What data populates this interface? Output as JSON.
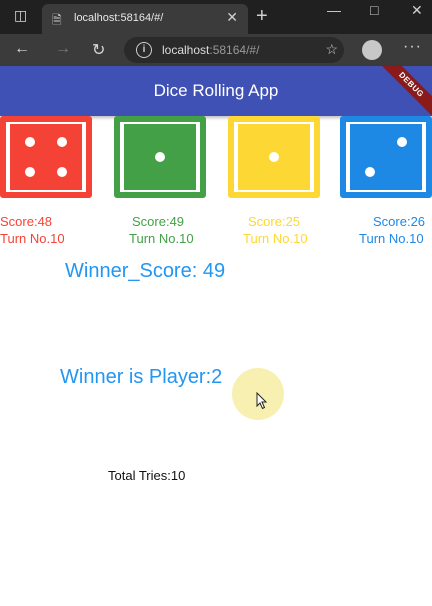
{
  "browser": {
    "tab_title": "localhost:58164/#/",
    "url_host": "localhost",
    "url_rest": ":58164/#/"
  },
  "app": {
    "title": "Dice Rolling App",
    "debug_banner": "DEBUG",
    "appbar_color": "#3f51b5"
  },
  "players": [
    {
      "color": "#f44336",
      "face": 4,
      "score_label": "Score:48",
      "turn_label": "Turn No.10"
    },
    {
      "color": "#43a047",
      "face": 1,
      "score_label": "Score:49",
      "turn_label": "Turn No.10"
    },
    {
      "color": "#fdd835",
      "face": 1,
      "score_label": "Score:25",
      "turn_label": "Turn No.10"
    },
    {
      "color": "#1e88e5",
      "face": 2,
      "score_label": "Score:26",
      "turn_label": "Turn No.10"
    }
  ],
  "results": {
    "winner_score": "Winner_Score: 49",
    "winner_player": "Winner is Player:2",
    "total_tries": "Total Tries:10"
  },
  "icons": [
    "sidebar-icon",
    "page-icon",
    "close-icon",
    "new-tab-icon",
    "minimize-icon",
    "maximize-icon",
    "window-close-icon",
    "back-icon",
    "forward-icon",
    "reload-icon",
    "info-icon",
    "favorite-icon",
    "profile-icon",
    "more-icon"
  ]
}
